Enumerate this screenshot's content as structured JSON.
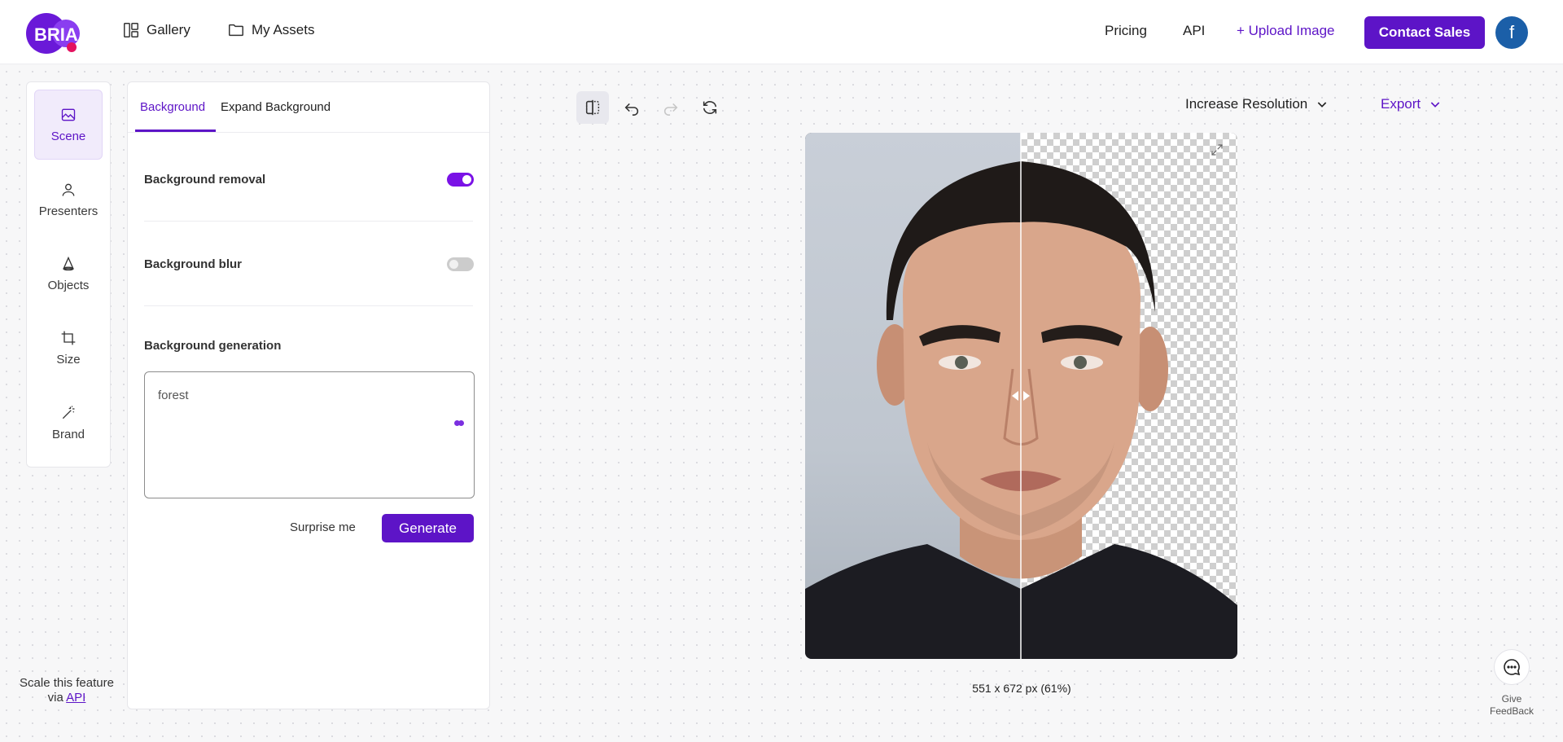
{
  "header": {
    "logo_text": "BRIA",
    "nav": [
      {
        "label": "Gallery",
        "icon": "gallery-icon"
      },
      {
        "label": "My Assets",
        "icon": "folder-icon"
      }
    ],
    "pricing_label": "Pricing",
    "api_label": "API",
    "upload_label": "+ Upload Image",
    "contact_label": "Contact Sales",
    "avatar_letter": "f"
  },
  "rail": {
    "items": [
      {
        "label": "Scene",
        "icon": "image-icon",
        "active": true
      },
      {
        "label": "Presenters",
        "icon": "person-icon"
      },
      {
        "label": "Objects",
        "icon": "cone-icon"
      },
      {
        "label": "Size",
        "icon": "crop-icon"
      },
      {
        "label": "Brand",
        "icon": "magic-wand-icon"
      }
    ]
  },
  "panel": {
    "tabs": [
      {
        "label": "Background",
        "active": true
      },
      {
        "label": "Expand Background"
      }
    ],
    "bg_removal_label": "Background removal",
    "bg_removal_on": true,
    "bg_blur_label": "Background blur",
    "bg_blur_on": false,
    "bg_gen_label": "Background generation",
    "prompt_value": "forest",
    "surprise_label": "Surprise me",
    "generate_label": "Generate"
  },
  "scale_note": {
    "text": "Scale this feature",
    "via": "via",
    "link": "API"
  },
  "toolbar": {
    "resolution_label": "Increase Resolution",
    "export_label": "Export"
  },
  "canvas": {
    "dimensions": "551 x 672 px (61%)"
  },
  "feedback": {
    "label_line1": "Give",
    "label_line2": "FeedBack"
  },
  "colors": {
    "accent": "#5d14c7",
    "toggle_on": "#7a12e6"
  }
}
